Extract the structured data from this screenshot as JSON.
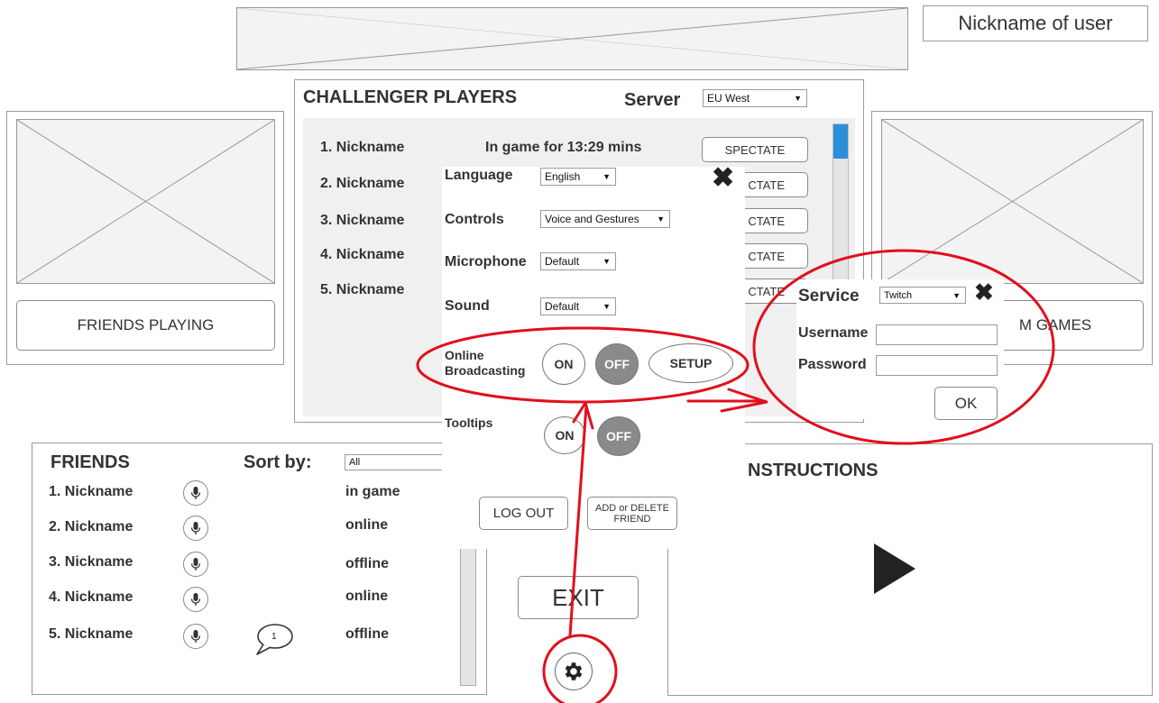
{
  "user": {
    "nickname": "Nickname of user"
  },
  "challenger": {
    "title": "CHALLENGER PLAYERS",
    "server_label": "Server",
    "server_value": "EU West",
    "players": [
      {
        "name": "1. Nickname",
        "status": "In game for 13:29 mins",
        "action": "SPECTATE"
      },
      {
        "name": "2. Nickname",
        "action": "CTATE"
      },
      {
        "name": "3. Nickname",
        "action": "CTATE"
      },
      {
        "name": "4. Nickname",
        "action": "CTATE"
      },
      {
        "name": "5. Nickname",
        "action": "CTATE"
      }
    ]
  },
  "friends_playing": {
    "label": "FRIENDS PLAYING"
  },
  "stream_games": {
    "label": "M GAMES"
  },
  "friends": {
    "title": "FRIENDS",
    "sort_label": "Sort by:",
    "sort_value": "All",
    "rows": [
      {
        "name": "1. Nickname",
        "status": "in game"
      },
      {
        "name": "2. Nickname",
        "status": "online"
      },
      {
        "name": "3. Nickname",
        "status": "offline"
      },
      {
        "name": "4. Nickname",
        "status": "online"
      },
      {
        "name": "5. Nickname",
        "status": "offline",
        "messages": "1"
      }
    ]
  },
  "settings": {
    "language_label": "Language",
    "language_value": "English",
    "controls_label": "Controls",
    "controls_value": "Voice and Gestures",
    "microphone_label": "Microphone",
    "microphone_value": "Default",
    "sound_label": "Sound",
    "sound_value": "Default",
    "broadcast_label_1": "Online",
    "broadcast_label_2": "Broadcasting",
    "on": "ON",
    "off": "OFF",
    "setup": "SETUP",
    "tooltips_label": "Tooltips",
    "logout": "LOG OUT",
    "add_delete_1": "ADD or DELETE",
    "add_delete_2": "FRIEND",
    "exit": "EXIT"
  },
  "service": {
    "label": "Service",
    "value": "Twitch",
    "username_label": "Username",
    "password_label": "Password",
    "ok": "OK"
  },
  "instructions": {
    "title": "NSTRUCTIONS"
  },
  "colors": {
    "annotation": "#e0101c",
    "scroll_thumb": "#2a8fd8",
    "toggle_on": "#8a8a8a"
  }
}
